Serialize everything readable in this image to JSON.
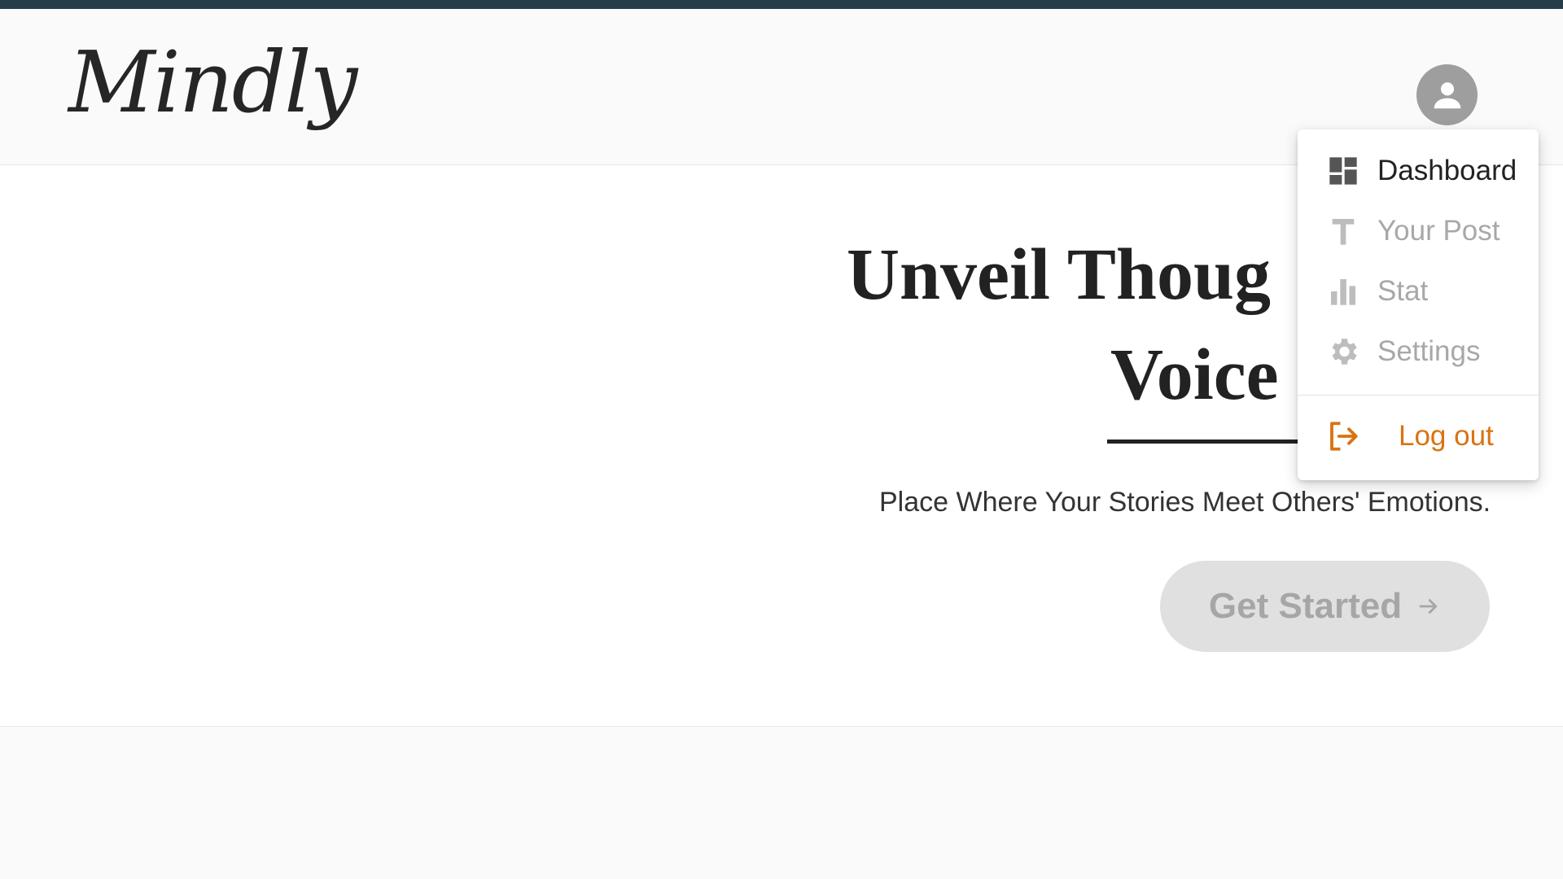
{
  "app": {
    "logo_text": "Mindly"
  },
  "colors": {
    "top_strip": "#263c4a",
    "accent_logout": "#d97312",
    "cta_bg": "#e0e0e0"
  },
  "header": {
    "avatar_icon": "account-circle-icon"
  },
  "hero": {
    "title_line1": "Unveil Thoug",
    "title_line2": "Voice",
    "tagline": "Place Where Your Stories Meet Others' Emotions.",
    "cta_label": "Get Started",
    "cta_icon": "arrow-right-icon"
  },
  "menu": {
    "items": [
      {
        "label": "Dashboard",
        "icon": "dashboard-icon",
        "state": "active"
      },
      {
        "label": "Your Post",
        "icon": "text-icon",
        "state": "disabled"
      },
      {
        "label": "Stat",
        "icon": "bar-chart-icon",
        "state": "disabled"
      },
      {
        "label": "Settings",
        "icon": "gear-icon",
        "state": "disabled"
      }
    ],
    "logout": {
      "label": "Log out",
      "icon": "logout-icon"
    }
  }
}
